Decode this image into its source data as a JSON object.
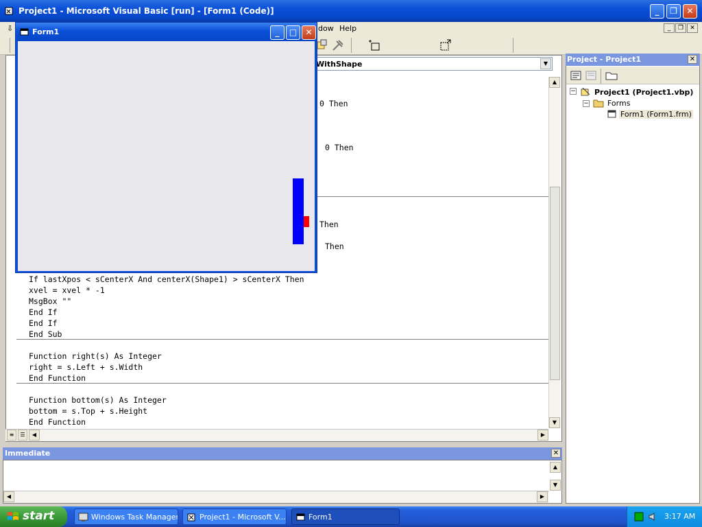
{
  "main_window": {
    "title": "Project1 - Microsoft Visual Basic [run] - [Form1 (Code)]"
  },
  "menu": {
    "items": [
      "dow",
      "Help"
    ]
  },
  "code_window": {
    "procedure_combo": "WithShape",
    "lines_partial": [
      {
        "text": "0 Then"
      },
      {
        "text": "0 Then"
      },
      {
        "text": "Then"
      },
      {
        "text": "Then"
      }
    ],
    "lines": [
      {
        "plain": "If lastXpos < sCenterX And centerX(Shape1) > sCenterX Then"
      },
      {
        "plain": "xvel = xvel * -1"
      },
      {
        "plain": "MsgBox \"\""
      },
      {
        "plain": "End If"
      },
      {
        "plain": "End If"
      },
      {
        "plain": "End Sub"
      },
      {
        "plain": "Function right(s) As Integer"
      },
      {
        "plain": "right = s.Left + s.Width"
      },
      {
        "plain": "End Function"
      },
      {
        "plain": "Function bottom(s) As Integer"
      },
      {
        "plain": "bottom = s.Top + s.Height"
      },
      {
        "plain": "End Function"
      }
    ]
  },
  "project_explorer": {
    "title": "Project - Project1",
    "tree": {
      "project": "Project1 (Project1.vbp)",
      "folder": "Forms",
      "form": "Form1 (Form1.frm)"
    }
  },
  "immediate": {
    "title": "Immediate"
  },
  "form1": {
    "title": "Form1",
    "paddle_color": "#0000ff",
    "ball_color": "#ff0000"
  },
  "taskbar": {
    "start_label": "start",
    "tasks": [
      {
        "label": "Windows Task Manager"
      },
      {
        "label": "Project1 - Microsoft V..."
      },
      {
        "label": "Form1"
      }
    ],
    "clock": "3:17 AM"
  }
}
